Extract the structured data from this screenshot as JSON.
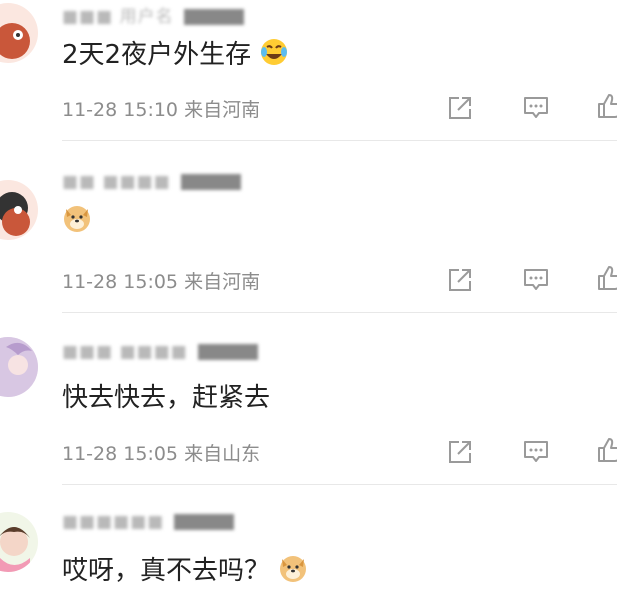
{
  "comments": [
    {
      "username": "■■■ 用户名",
      "text": "2天2夜户外生存",
      "emoji": "laughing-tears-emoji",
      "date": "11-28",
      "time": "15:10",
      "location": "来自河南"
    },
    {
      "username": "■■ ■■■■",
      "text": "",
      "emoji": "doge-emoji",
      "date": "11-28",
      "time": "15:05",
      "location": "来自河南"
    },
    {
      "username": "■■■ ■■■■",
      "text": "快去快去，赶紧去",
      "emoji": "",
      "date": "11-28",
      "time": "15:05",
      "location": "来自山东"
    },
    {
      "username": "■■■■■■",
      "text": "哎呀，真不去吗？",
      "emoji": "doge-emoji",
      "date": "",
      "time": "",
      "location": ""
    }
  ],
  "actions": [
    "share-icon",
    "comment-icon",
    "like-icon"
  ],
  "colors": {
    "text": "#222222",
    "meta": "#8c8c8c",
    "icon": "#9a9a9a",
    "divider": "#e8e8e8"
  }
}
